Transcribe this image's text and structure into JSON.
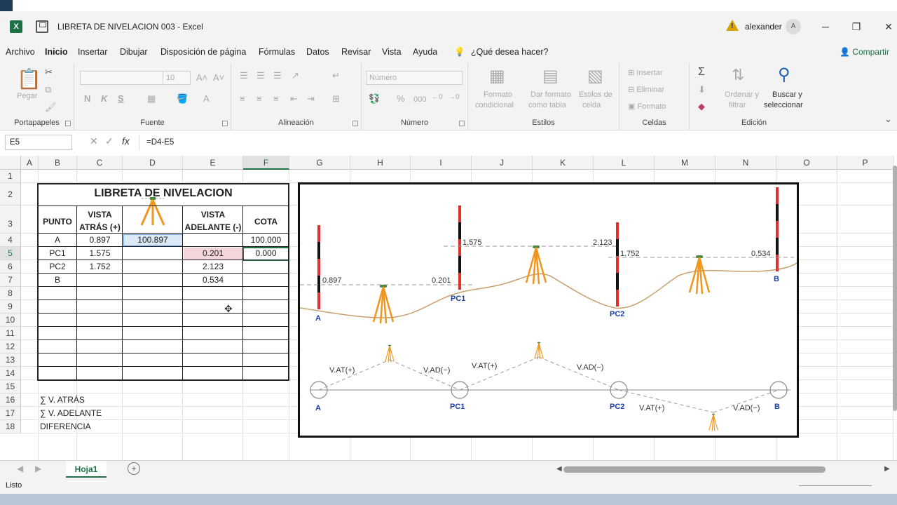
{
  "window": {
    "title": "LIBRETA DE NIVELACION 003  -  Excel",
    "app_icon": "excel-icon",
    "user": "alexander",
    "avatar_initial": "A",
    "minimize": "─",
    "restore": "❐",
    "close": "✕"
  },
  "menu": {
    "items": [
      "Archivo",
      "Inicio",
      "Insertar",
      "Dibujar",
      "Disposición de página",
      "Fórmulas",
      "Datos",
      "Revisar",
      "Vista",
      "Ayuda"
    ],
    "tell_me": "¿Qué desea hacer?",
    "share": "Compartir"
  },
  "ribbon": {
    "clipboard": {
      "label": "Portapapeles",
      "paste": "Pegar"
    },
    "font": {
      "label": "Fuente",
      "size": "10",
      "bold": "N",
      "italic": "K",
      "underline": "S"
    },
    "alignment": {
      "label": "Alineación"
    },
    "number": {
      "label": "Número",
      "format": "Número",
      "percent": "%",
      "thousands": "000"
    },
    "styles": {
      "label": "Estilos",
      "cond_format_1": "Formato",
      "cond_format_2": "condicional",
      "table_1": "Dar formato",
      "table_2": "como tabla",
      "cell_styles_1": "Estilos de",
      "cell_styles_2": "celda"
    },
    "cells": {
      "label": "Celdas",
      "insert": "Insertar",
      "delete": "Eliminar",
      "format": "Formato"
    },
    "editing": {
      "label": "Edición",
      "sort_1": "Ordenar y",
      "sort_2": "filtrar",
      "find_1": "Buscar y",
      "find_2": "seleccionar"
    }
  },
  "formula_bar": {
    "name_box": "E5",
    "formula": "=D4-E5"
  },
  "columns": [
    "A",
    "B",
    "C",
    "D",
    "E",
    "F",
    "G",
    "H",
    "I",
    "J",
    "K",
    "L",
    "M",
    "N",
    "O",
    "P"
  ],
  "rows": [
    "1",
    "2",
    "3",
    "4",
    "5",
    "6",
    "7",
    "8",
    "9",
    "10",
    "11",
    "12",
    "13",
    "14",
    "15",
    "16",
    "17",
    "18"
  ],
  "table": {
    "title": "LIBRETA DE NIVELACION",
    "headers": {
      "punto": "PUNTO",
      "vista_atras_1": "VISTA",
      "vista_atras_2": "ATRÁS (+)",
      "vista_adelante_1": "VISTA",
      "vista_adelante_2": "ADELANTE (-)",
      "cota": "COTA"
    },
    "rows": [
      {
        "punto": "A",
        "atras": "0.897",
        "hi": "100.897",
        "adelante": "",
        "cota": "100.000"
      },
      {
        "punto": "PC1",
        "atras": "1.575",
        "hi": "",
        "adelante": "0.201",
        "cota": "0.000"
      },
      {
        "punto": "PC2",
        "atras": "1.752",
        "hi": "",
        "adelante": "2.123",
        "cota": ""
      },
      {
        "punto": "B",
        "atras": "",
        "hi": "",
        "adelante": "0.534",
        "cota": ""
      }
    ]
  },
  "summary": {
    "sum_atras": "∑ V. ATRÁS",
    "sum_adelante": "∑ V. ADELANTE",
    "diferencia": "DIFERENCIA"
  },
  "diagram": {
    "rod_labels": [
      "A",
      "PC1",
      "PC2",
      "B"
    ],
    "readings": [
      "0.897",
      "0.201",
      "1.575",
      "2.123",
      "1.752",
      "0.534"
    ],
    "schema_labels": [
      "V.AT(+)",
      "V.AD(−)",
      "V.AT(+)",
      "V.AD(−)",
      "V.AT(+)",
      "V.AD(−)"
    ],
    "colors": {
      "rod_red": "#e03030",
      "rod_black": "#111111",
      "tripod": "#f0961e",
      "ground": "#c8a070",
      "label_blue": "#1a3fa8"
    }
  },
  "sheet_tab": "Hoja1",
  "status": "Listo"
}
